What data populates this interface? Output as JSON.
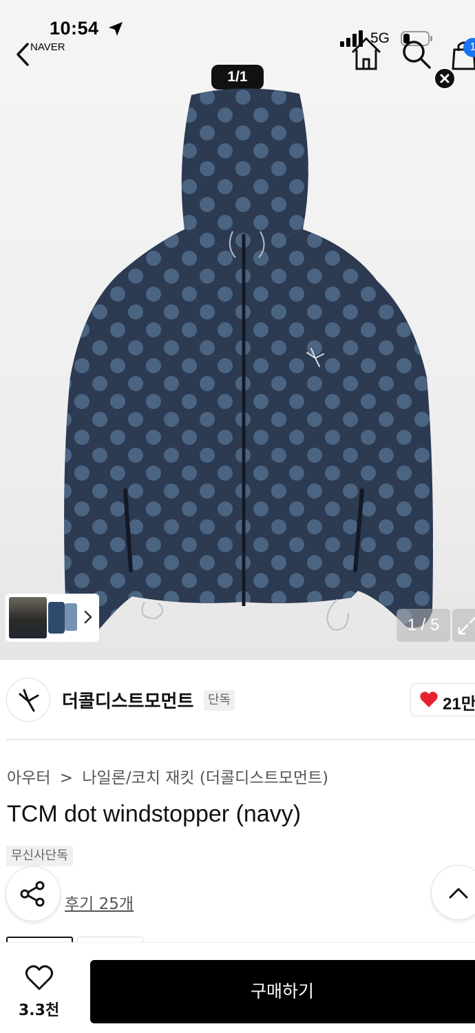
{
  "status_bar": {
    "time": "10:54",
    "back_app": "NAVER",
    "network": "5G"
  },
  "nav": {
    "icons": [
      "back-chevron-icon",
      "home-icon",
      "search-icon",
      "cart-icon"
    ],
    "cart_badge": "1"
  },
  "gallery": {
    "top_counter": "1/1",
    "bottom_counter": "1 / 5"
  },
  "brand": {
    "name": "더콜디스트모먼트",
    "tag": "단독",
    "like_count": "21만"
  },
  "product": {
    "breadcrumb": [
      "아우터",
      "나일론/코치 재킷 (더콜디스트모먼트)"
    ],
    "breadcrumb_separator": ">",
    "title": "TCM dot windstopper (navy)",
    "badge": "무신사단독",
    "review_link": "후기 25개"
  },
  "bottom_bar": {
    "wish_count": "3.3천",
    "buy_label": "구매하기"
  },
  "colors": {
    "accent_heart": "#e8212e",
    "cart_badge": "#1b74f0",
    "buy_button": "#000000",
    "jacket_navy": "#2c3a52",
    "jacket_dots": "#4b6482"
  }
}
